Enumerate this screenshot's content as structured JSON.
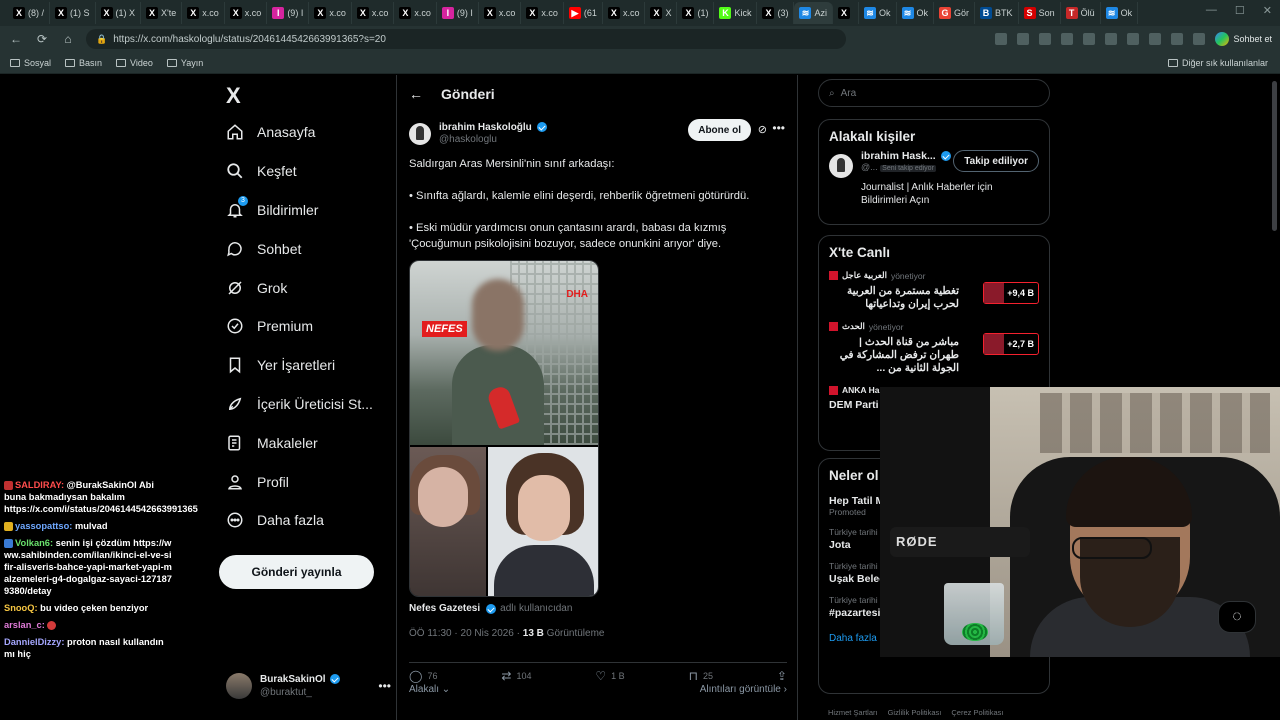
{
  "browser": {
    "tabs": [
      {
        "icon": "X",
        "label": "(8) /",
        "color": "#000000"
      },
      {
        "icon": "X",
        "label": "(1) S",
        "color": "#000000"
      },
      {
        "icon": "X",
        "label": "(1) X",
        "color": "#000000"
      },
      {
        "icon": "X",
        "label": "X'te",
        "color": "#000000"
      },
      {
        "icon": "X",
        "label": "x.co",
        "color": "#000000"
      },
      {
        "icon": "X",
        "label": "x.co",
        "color": "#000000"
      },
      {
        "icon": "I",
        "label": "(9) I",
        "color": "#d6249f"
      },
      {
        "icon": "X",
        "label": "x.co",
        "color": "#000000"
      },
      {
        "icon": "X",
        "label": "x.co",
        "color": "#000000"
      },
      {
        "icon": "X",
        "label": "x.co",
        "color": "#000000"
      },
      {
        "icon": "I",
        "label": "(9) I",
        "color": "#d6249f"
      },
      {
        "icon": "X",
        "label": "x.co",
        "color": "#000000"
      },
      {
        "icon": "X",
        "label": "x.co",
        "color": "#000000"
      },
      {
        "icon": "▶",
        "label": "(61",
        "color": "#ff0000"
      },
      {
        "icon": "X",
        "label": "x.co",
        "color": "#000000"
      },
      {
        "icon": "X",
        "label": "X",
        "color": "#000000"
      },
      {
        "icon": "X",
        "label": "(1)",
        "color": "#000000"
      },
      {
        "icon": "K",
        "label": "Kick",
        "color": "#53fc18"
      },
      {
        "icon": "X",
        "label": "(3)",
        "color": "#000000"
      },
      {
        "icon": "≋",
        "label": "Azi",
        "color": "#1e88e5"
      },
      {
        "icon": "X",
        "label": "",
        "color": "#000000"
      },
      {
        "icon": "≋",
        "label": "Ok",
        "color": "#1e88e5"
      },
      {
        "icon": "≋",
        "label": "Ok",
        "color": "#1e88e5"
      },
      {
        "icon": "G",
        "label": "Gör",
        "color": "#ea4335"
      },
      {
        "icon": "B",
        "label": "BTK",
        "color": "#004b93"
      },
      {
        "icon": "S",
        "label": "Son",
        "color": "#d50000"
      },
      {
        "icon": "T",
        "label": "Ölü",
        "color": "#c62828"
      },
      {
        "icon": "≋",
        "label": "Ok",
        "color": "#1e88e5"
      }
    ],
    "url": "https://x.com/haskologlu/status/2046144542663991365?s=20",
    "copilot_label": "Sohbet et",
    "bookmarks": [
      "Sosyal",
      "Basın",
      "Video",
      "Yayın"
    ],
    "other_bookmarks": "Diğer sık kullanılanlar"
  },
  "nav": {
    "logo": "X",
    "items": [
      {
        "label": "Anasayfa",
        "icon": "home-icon"
      },
      {
        "label": "Keşfet",
        "icon": "search-icon"
      },
      {
        "label": "Bildirimler",
        "icon": "bell-icon",
        "badge": "3"
      },
      {
        "label": "Sohbet",
        "icon": "chat-icon"
      },
      {
        "label": "Grok",
        "icon": "grok-icon"
      },
      {
        "label": "Premium",
        "icon": "premium-icon"
      },
      {
        "label": "Yer İşaretleri",
        "icon": "bookmark-icon"
      },
      {
        "label": "İçerik Üreticisi St...",
        "icon": "rocket-icon"
      },
      {
        "label": "Makaleler",
        "icon": "article-icon"
      },
      {
        "label": "Profil",
        "icon": "person-icon"
      },
      {
        "label": "Daha fazla",
        "icon": "more-circle-icon"
      }
    ],
    "post_button": "Gönderi yayınla",
    "account": {
      "name": "BurakSakinOl",
      "handle": "@buraktut_"
    }
  },
  "chat": [
    {
      "user": "SALDIRAY:",
      "color": "red",
      "text": "@BurakSakinOl Abi buna bakmadıysan bakalım https://x.com/i/status/2046144542663991365"
    },
    {
      "user": "yassopattso:",
      "color": "blue",
      "text": "mulvad"
    },
    {
      "user": "Volkan6:",
      "color": "green",
      "text": "senin işi çözdüm https://www.sahibinden.com/ilan/ikinci-el-ve-sifir-alisveris-bahce-yapi-market-yapi-malzemeleri-g4-dogalgaz-sayaci-1271879380/detay"
    },
    {
      "user": "SnooQ:",
      "color": "yellow",
      "text": "bu video çeken benziyor"
    },
    {
      "user": "arslan_c:",
      "color": "pink",
      "text": ""
    },
    {
      "user": "DannielDizzy:",
      "color": "lav",
      "text": "proton nasıl kullandın mı hiç"
    }
  ],
  "post": {
    "header_title": "Gönderi",
    "author_name": "ibrahim Haskoloğlu",
    "author_handle": "@haskologlu",
    "follow_label": "Abone ol",
    "paragraphs": [
      "Saldırgan Aras Mersinli'nin sınıf arkadaşı:",
      "• Sınıfta ağlardı, kalemle elini deşerdi, rehberlik öğretmeni götürürdü.",
      "• Eski müdür yardımcısı onun çantasını arardı, babası da kızmış 'Çocuğumun psikolojisini bozuyor, sadece onunkini arıyor' diye."
    ],
    "media_tag": "NEFES",
    "media_logo": "DHA",
    "source_name": "Nefes Gazetesi",
    "source_desc": "adlı kullanıcıdan",
    "time": "ÖÖ 11:30 · 20 Nis 2026 · ",
    "views_count": "13 B",
    "views_label": " Görüntüleme",
    "stats": {
      "replies": "76",
      "reposts": "104",
      "likes": "1 B",
      "bookmarks": "25"
    },
    "related_label": "Alakalı",
    "quotes_label": "Alıntıları görüntüle"
  },
  "sidebar": {
    "search_placeholder": "Ara",
    "related_title": "Alakalı kişiler",
    "related_person": {
      "name": "ibrahim Hask...",
      "handle": "@...",
      "follows_you": "Seni takip ediyor",
      "button": "Takip ediliyor",
      "bio": "Journalist | Anlık Haberler için Bildirimleri Açın"
    },
    "live_title": "X'te Canlı",
    "live_items": [
      {
        "source": "العربية عاجل",
        "role": "yönetiyor",
        "text": "تغطية مستمرة من العربية لحرب إيران وتداعياتها",
        "count": "+9,4 B"
      },
      {
        "source": "الحدث",
        "role": "yönetiyor",
        "text": "مباشر من قناة الحدث | طهران ترفض المشاركة في الجولة الثانية من ...",
        "count": "+2,7 B"
      },
      {
        "source": "ANKA Ha",
        "role": "",
        "text": "DEM Parti Gülistan K",
        "count": ""
      }
    ],
    "trends_title": "Neler ol",
    "trends": [
      {
        "context": "",
        "name": "Hep Tatil M",
        "promoted": "Promoted"
      },
      {
        "context": "Türkiye tarihi",
        "name": "Jota"
      },
      {
        "context": "Türkiye tarihi",
        "name": "Uşak Belec"
      },
      {
        "context": "Türkiye tarihi",
        "name": "#pazartesi"
      }
    ],
    "show_more": "Daha fazla göster",
    "footer": [
      "Hizmet Şartları",
      "Gizlilik Politikası",
      "Çerez Politikası"
    ]
  },
  "webcam": {
    "mic_brand": "RØDE"
  }
}
